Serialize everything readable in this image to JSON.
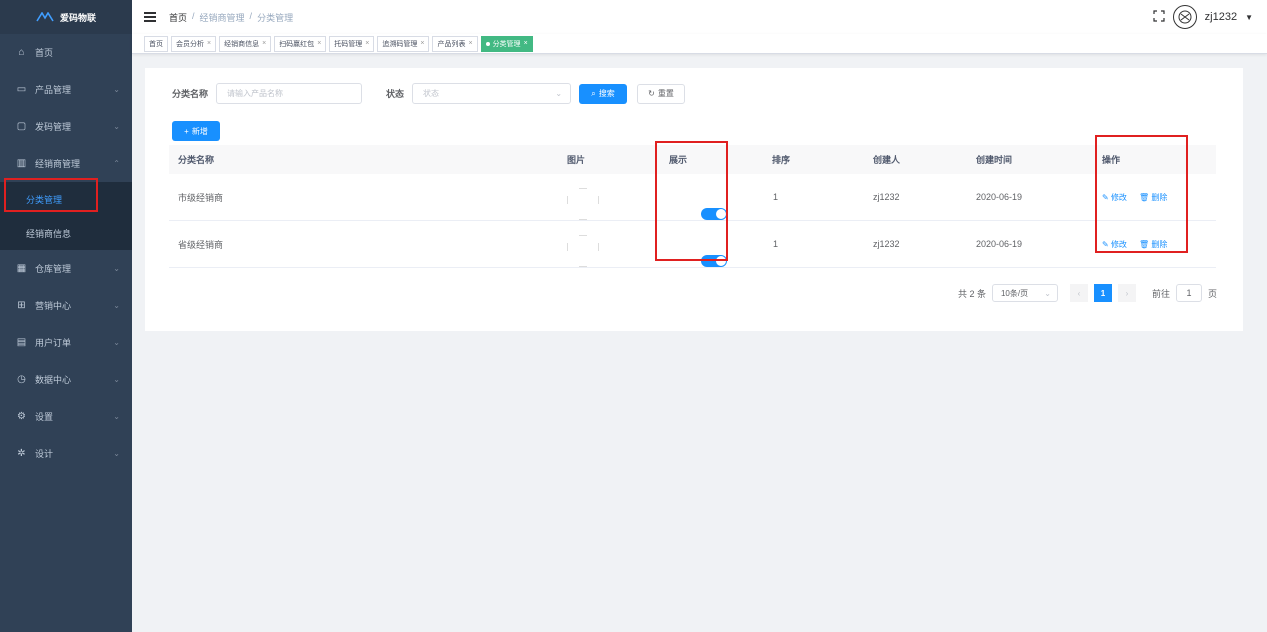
{
  "sidebar": {
    "logo_text": "爱码物联",
    "items": [
      {
        "label": "首页",
        "icon": "home-icon",
        "arrow": ""
      },
      {
        "label": "产品管理",
        "icon": "box-icon",
        "arrow": "⌄"
      },
      {
        "label": "发码管理",
        "icon": "qrcode-icon",
        "arrow": "⌄"
      },
      {
        "label": "经销商管理",
        "icon": "building-icon",
        "arrow": "⌃"
      },
      {
        "label": "仓库管理",
        "icon": "warehouse-icon",
        "arrow": "⌄"
      },
      {
        "label": "营销中心",
        "icon": "gift-icon",
        "arrow": "⌄"
      },
      {
        "label": "用户订单",
        "icon": "order-icon",
        "arrow": "⌄"
      },
      {
        "label": "数据中心",
        "icon": "chart-icon",
        "arrow": "⌄"
      },
      {
        "label": "设置",
        "icon": "gear-icon",
        "arrow": "⌄"
      },
      {
        "label": "设计",
        "icon": "design-icon",
        "arrow": "⌄"
      }
    ],
    "sub_items": [
      {
        "label": "分类管理"
      },
      {
        "label": "经销商信息"
      }
    ]
  },
  "header": {
    "breadcrumb": [
      "首页",
      "/",
      "经销商管理",
      "/",
      "分类管理"
    ],
    "username": "zj1232"
  },
  "tags": [
    {
      "label": "首页",
      "closable": false
    },
    {
      "label": "会员分析",
      "closable": true
    },
    {
      "label": "经销商信息",
      "closable": true
    },
    {
      "label": "扫码赢红包",
      "closable": true
    },
    {
      "label": "托码管理",
      "closable": true
    },
    {
      "label": "追溯码管理",
      "closable": true
    },
    {
      "label": "产品列表",
      "closable": true
    },
    {
      "label": "分类管理",
      "closable": true,
      "active": true
    }
  ],
  "search": {
    "name_label": "分类名称",
    "name_placeholder": "请输入产品名称",
    "status_label": "状态",
    "status_placeholder": "状态",
    "search_button": "搜索",
    "reset_button": "重置"
  },
  "add_button": "新增",
  "table": {
    "columns": [
      "分类名称",
      "图片",
      "展示",
      "排序",
      "创建人",
      "创建时间",
      "操作"
    ],
    "rows": [
      {
        "name": "市级经销商",
        "show": true,
        "sort": "1",
        "creator": "zj1232",
        "created": "2020-06-19",
        "edit": "修改",
        "delete": "删除"
      },
      {
        "name": "省级经销商",
        "show": true,
        "sort": "1",
        "creator": "zj1232",
        "created": "2020-06-19",
        "edit": "修改",
        "delete": "删除"
      }
    ]
  },
  "pagination": {
    "total": "共 2 条",
    "page_size": "10条/页",
    "current_page": "1",
    "goto_label": "前往",
    "goto_value": "1",
    "page_suffix": "页"
  },
  "colors": {
    "sidebar_bg": "#304156",
    "primary": "#1890ff",
    "active_tag": "#42b983",
    "highlight_box": "#e02020"
  }
}
